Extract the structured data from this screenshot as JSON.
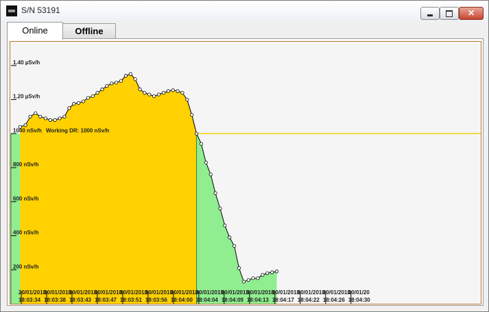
{
  "window": {
    "title": "S/N 53191",
    "icon": "device-icon"
  },
  "tabs": [
    {
      "label": "Online",
      "active": true
    },
    {
      "label": "Offline",
      "active": false
    }
  ],
  "chart_data": {
    "type": "area",
    "threshold": {
      "label": "Working DR: 1000 nSv/h",
      "value": 1000,
      "color": "#f5d000"
    },
    "colors": {
      "above": "#ffd100",
      "below": "#90ee90",
      "line": "#000000",
      "marker": "#ffffff"
    },
    "y_ticks": [
      {
        "value": 200,
        "label": "200 nSv/h"
      },
      {
        "value": 400,
        "label": "400 nSv/h"
      },
      {
        "value": 600,
        "label": "600 nSv/h"
      },
      {
        "value": 800,
        "label": "800 nSv/h"
      },
      {
        "value": 1000,
        "label": "1000 nSv/h"
      },
      {
        "value": 1200,
        "label": "1.20 µSv/h"
      },
      {
        "value": 1400,
        "label": "1.40 µSv/h"
      }
    ],
    "ylim": [
      0,
      1540
    ],
    "xlim": [
      0,
      68
    ],
    "x_ticks": [
      {
        "t": 0,
        "date": "20/01/2018",
        "time": "18:03:34"
      },
      {
        "t": 4.3,
        "date": "20/01/2018",
        "time": "18:03:38"
      },
      {
        "t": 8.6,
        "date": "20/01/2018",
        "time": "18:03:43"
      },
      {
        "t": 12.9,
        "date": "20/01/2018",
        "time": "18:03:47"
      },
      {
        "t": 17.2,
        "date": "20/01/2018",
        "time": "18:03:51"
      },
      {
        "t": 21.5,
        "date": "20/01/2018",
        "time": "18:03:56"
      },
      {
        "t": 25.8,
        "date": "20/01/2018",
        "time": "18:04:00"
      },
      {
        "t": 30.1,
        "date": "20/01/2018",
        "time": "18:04:04"
      },
      {
        "t": 34.4,
        "date": "20/01/2018",
        "time": "18:04:09"
      },
      {
        "t": 38.7,
        "date": "20/01/2018",
        "time": "18:04:13"
      },
      {
        "t": 43.0,
        "date": "20/01/2018",
        "time": "18:04:17"
      },
      {
        "t": 47.3,
        "date": "20/01/2018",
        "time": "18:04:22"
      },
      {
        "t": 51.6,
        "date": "20/01/2018",
        "time": "18:04:26"
      },
      {
        "t": 55.9,
        "date": "20/01/20",
        "time": "18:04:30"
      }
    ],
    "x": [
      0.4,
      1.3,
      2.1,
      3.0,
      3.8,
      4.7,
      5.5,
      6.3,
      7.1,
      7.9,
      8.7,
      9.5,
      10.3,
      11.1,
      11.9,
      12.7,
      13.5,
      14.3,
      15.1,
      15.9,
      16.7,
      17.5,
      18.3,
      19.1,
      19.9,
      20.7,
      21.5,
      22.3,
      23.1,
      23.9,
      24.7,
      25.5,
      26.3,
      27.1,
      27.9,
      28.7,
      29.5,
      30.3,
      31.1,
      31.9,
      32.7,
      33.5,
      34.3,
      35.1,
      35.9,
      36.7,
      37.5,
      38.3,
      39.1,
      39.9,
      40.7,
      41.5,
      42.3,
      43.1,
      43.9
    ],
    "values": [
      1040,
      1050,
      1100,
      1120,
      1100,
      1090,
      1080,
      1080,
      1090,
      1100,
      1150,
      1175,
      1180,
      1190,
      1210,
      1220,
      1240,
      1260,
      1280,
      1295,
      1300,
      1310,
      1340,
      1350,
      1320,
      1260,
      1240,
      1230,
      1220,
      1230,
      1240,
      1250,
      1255,
      1250,
      1240,
      1200,
      1110,
      1000,
      940,
      830,
      760,
      650,
      560,
      460,
      390,
      340,
      210,
      130,
      140,
      150,
      150,
      170,
      180,
      185,
      190
    ]
  }
}
